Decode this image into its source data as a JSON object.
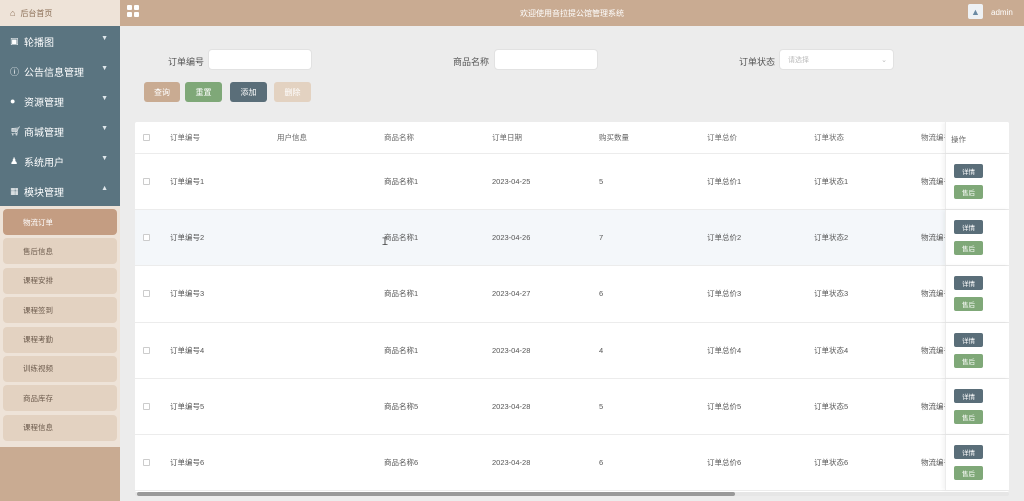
{
  "sidebar": {
    "home_label": "后台首页",
    "menu": [
      {
        "label": "轮播图",
        "icon": "image-icon"
      },
      {
        "label": "公告信息管理",
        "icon": "info-icon"
      },
      {
        "label": "资源管理",
        "icon": "location-icon"
      },
      {
        "label": "商城管理",
        "icon": "cart-icon"
      },
      {
        "label": "系统用户",
        "icon": "user-icon"
      },
      {
        "label": "模块管理",
        "icon": "grid-icon"
      }
    ],
    "submenu": [
      "物流订单",
      "售后信息",
      "课程安排",
      "课程签到",
      "课程考勤",
      "训练视频",
      "商品库存",
      "课程信息"
    ]
  },
  "header": {
    "title": "欢迎使用音拉提公馆管理系统",
    "user": "admin"
  },
  "filters": {
    "order_no_label": "订单编号",
    "order_no_value": "",
    "product_label": "商品名称",
    "product_value": "",
    "status_label": "订单状态",
    "status_placeholder": "请选择"
  },
  "buttons": {
    "search": "查询",
    "reset": "重置",
    "add": "添加",
    "delete": "删除"
  },
  "colors": {
    "primary": "#c9ab92",
    "nav": "#5a7480",
    "query": "#c9ab92",
    "reset": "#7fa878",
    "add": "#5a6e79",
    "delete": "#e3d2c1"
  },
  "table": {
    "columns": [
      "订单编号",
      "用户信息",
      "商品名称",
      "订单日期",
      "购买数量",
      "订单总价",
      "订单状态",
      "物流编号"
    ],
    "ops_header": "操作",
    "detail_label": "详情",
    "aftersale_label": "售后",
    "rows": [
      [
        "订单编号1",
        "",
        "商品名称1",
        "2023-04-25",
        "5",
        "订单总价1",
        "订单状态1",
        "物流编号"
      ],
      [
        "订单编号2",
        "",
        "商品名称1",
        "2023-04-26",
        "7",
        "订单总价2",
        "订单状态2",
        "物流编号"
      ],
      [
        "订单编号3",
        "",
        "商品名称1",
        "2023-04-27",
        "6",
        "订单总价3",
        "订单状态3",
        "物流编号"
      ],
      [
        "订单编号4",
        "",
        "商品名称1",
        "2023-04-28",
        "4",
        "订单总价4",
        "订单状态4",
        "物流编号"
      ],
      [
        "订单编号5",
        "",
        "商品名称5",
        "2023-04-28",
        "5",
        "订单总价5",
        "订单状态5",
        "物流编号"
      ],
      [
        "订单编号6",
        "",
        "商品名称6",
        "2023-04-28",
        "6",
        "订单总价6",
        "订单状态6",
        "物流编号"
      ]
    ]
  }
}
